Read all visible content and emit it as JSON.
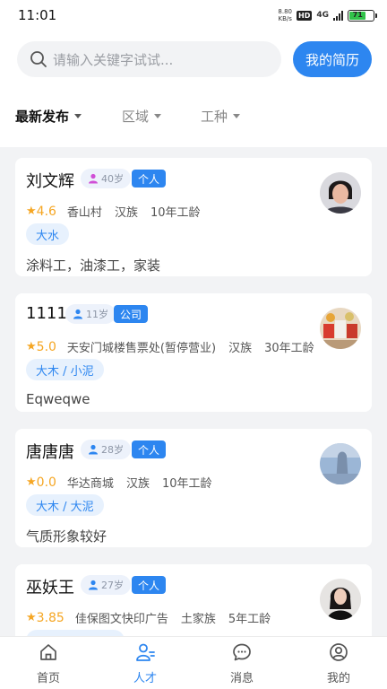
{
  "status_bar": {
    "time": "11:01",
    "net_speed_value": "8.80",
    "net_speed_unit": "KB/s",
    "hd": "HD",
    "signal": "4G",
    "battery": "71"
  },
  "search": {
    "placeholder": "请输入关键字试试..."
  },
  "resume_button": "我的简历",
  "filters": [
    {
      "label": "最新发布",
      "active": true
    },
    {
      "label": "区域",
      "active": false
    },
    {
      "label": "工种",
      "active": false
    }
  ],
  "candidates": [
    {
      "name": "刘文辉",
      "age": "40岁",
      "gender": "female",
      "type": "个人",
      "rating": "4.6",
      "location": "香山村",
      "ethnicity": "汉族",
      "experience": "10年工龄",
      "skills": "大水",
      "description": "涂料工，油漆工，家装"
    },
    {
      "name": "1111",
      "age": "11岁",
      "gender": "male",
      "type": "公司",
      "rating": "5.0",
      "location": "天安门城楼售票处(暂停营业)",
      "ethnicity": "汉族",
      "experience": "30年工龄",
      "skills": "大木 / 小泥",
      "description": "Eqweqwe"
    },
    {
      "name": "唐唐唐",
      "age": "28岁",
      "gender": "male",
      "type": "个人",
      "rating": "0.0",
      "location": "华达商城",
      "ethnicity": "汉族",
      "experience": "10年工龄",
      "skills": "大木 / 大泥",
      "description": "气质形象较好"
    },
    {
      "name": "巫妖王",
      "age": "27岁",
      "gender": "male",
      "type": "个人",
      "rating": "3.85",
      "location": "佳保图文快印广告",
      "ethnicity": "土家族",
      "experience": "5年工龄",
      "skills": "",
      "description": ""
    }
  ],
  "tabbar": [
    {
      "label": "首页",
      "icon": "home-icon",
      "active": false
    },
    {
      "label": "人才",
      "icon": "talent-icon",
      "active": true
    },
    {
      "label": "消息",
      "icon": "message-icon",
      "active": false
    },
    {
      "label": "我的",
      "icon": "profile-icon",
      "active": false
    }
  ],
  "colors": {
    "accent": "#2d86f0",
    "star": "#f5a623",
    "female": "#d04fd6",
    "background": "#f2f3f5"
  }
}
